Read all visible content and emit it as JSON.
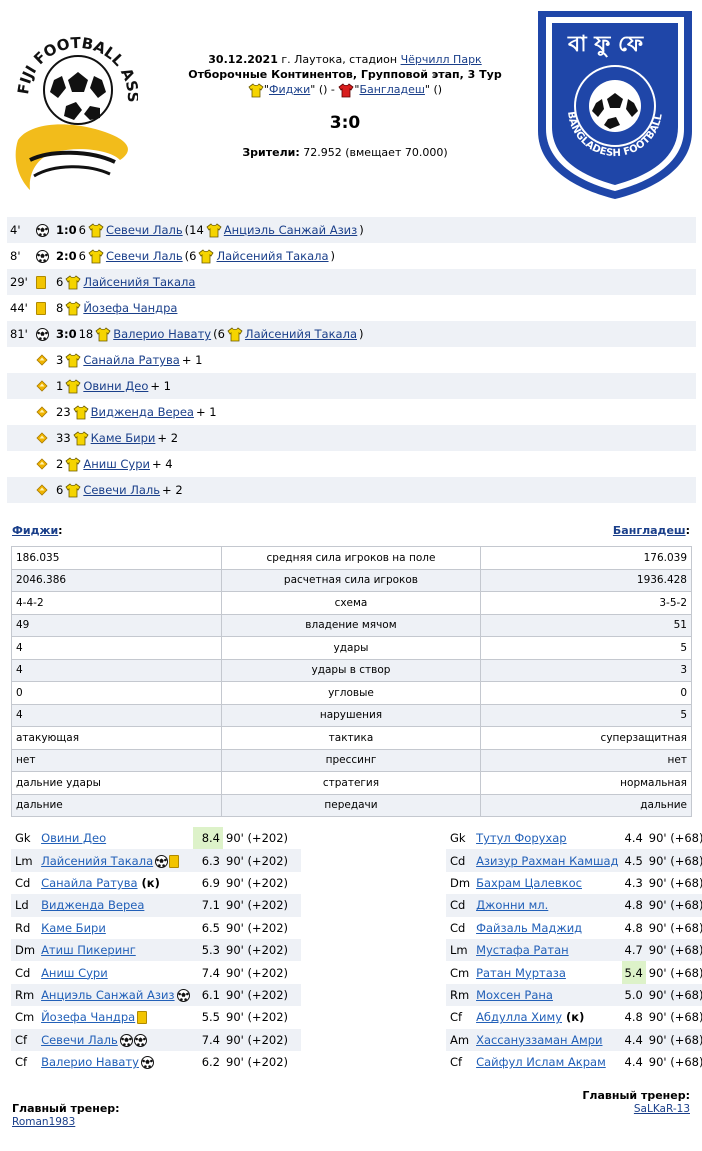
{
  "match": {
    "date": "30.12.2021",
    "venue_prefix": " г. Лаутока, стадион ",
    "stadium": "Чёрчилл Парк",
    "tournament": "Отборочные Континентов, Групповой этап, 3 Тур",
    "home_team": "Фиджи",
    "away_team": "Бангладеш",
    "home_extra": " ()",
    "away_extra": " ()",
    "separator": " - ",
    "score": "3:0",
    "attendance_label": "Зрители:",
    "attendance_value": " 72.952 (вмещает 70.000)"
  },
  "logos": {
    "left_text": "FIJI FOOTBALL ASSOCIATION",
    "right_text": "BANGLADESH FOOTBALL FEDERATION"
  },
  "colors": {
    "home_shirt": "#f5d400",
    "away_shirt": "#d81e1e",
    "link": "#1a3f8a",
    "alt_row": "#eef1f6",
    "highlight": "#ddf2c9",
    "card": "#f2c400"
  },
  "events": [
    {
      "minute": "4'",
      "icon": "ball-icon",
      "score": "1:0",
      "number": "6",
      "player": "Севечи Лаль",
      "assist_open": " (14",
      "assist": "Анциэль Санжай Азиз",
      "assist_close": ")"
    },
    {
      "minute": "8'",
      "icon": "ball-icon",
      "score": "2:0",
      "number": "6",
      "player": "Севечи Лаль",
      "assist_open": " (6",
      "assist": "Лайсенийя Такала",
      "assist_close": ")"
    },
    {
      "minute": "29'",
      "icon": "yellow-card-icon",
      "number": "6",
      "player": "Лайсенийя Такала"
    },
    {
      "minute": "44'",
      "icon": "yellow-card-icon",
      "number": "8",
      "player": "Йозефа Чандра"
    },
    {
      "minute": "81'",
      "icon": "ball-icon",
      "score": "3:0",
      "number": "18",
      "player": "Валерио Навату",
      "assist_open": " (6",
      "assist": "Лайсенийя Такала",
      "assist_close": ")"
    },
    {
      "icon": "rating-up-icon",
      "number": "3",
      "player": "Санайла Ратува",
      "suffix": " + 1"
    },
    {
      "icon": "rating-up-icon",
      "number": "1",
      "player": "Овини Део",
      "suffix": " + 1"
    },
    {
      "icon": "rating-up-icon",
      "number": "23",
      "player": "Видженда Вереа",
      "suffix": " + 1"
    },
    {
      "icon": "rating-up-icon",
      "number": "33",
      "player": "Каме Бири",
      "suffix": " + 2"
    },
    {
      "icon": "rating-up-icon",
      "number": "2",
      "player": "Аниш Сури",
      "suffix": " + 4"
    },
    {
      "icon": "rating-up-icon",
      "number": "6",
      "player": "Севечи Лаль",
      "suffix": " + 2"
    }
  ],
  "teams": {
    "home_label": "Фиджи",
    "away_label": "Бангладеш",
    "colon": ":"
  },
  "stats": [
    {
      "home": "186.035",
      "label": "средняя сила игроков на поле",
      "away": "176.039"
    },
    {
      "home": "2046.386",
      "label": "расчетная сила игроков",
      "away": "1936.428"
    },
    {
      "home": "4-4-2",
      "label": "схема",
      "away": "3-5-2"
    },
    {
      "home": "49",
      "label": "владение мячом",
      "away": "51"
    },
    {
      "home": "4",
      "label": "удары",
      "away": "5"
    },
    {
      "home": "4",
      "label": "удары в створ",
      "away": "3"
    },
    {
      "home": "0",
      "label": "угловые",
      "away": "0"
    },
    {
      "home": "4",
      "label": "нарушения",
      "away": "5"
    },
    {
      "home": "атакующая",
      "label": "тактика",
      "away": "суперзащитная"
    },
    {
      "home": "нет",
      "label": "прессинг",
      "away": "нет"
    },
    {
      "home": "дальние удары",
      "label": "стратегия",
      "away": "нормальная"
    },
    {
      "home": "дальние",
      "label": "передачи",
      "away": "дальние"
    }
  ],
  "lineup_home": [
    {
      "pos": "Gk",
      "name": "Овини Део",
      "extra": "",
      "icons": [],
      "rating": "8.4",
      "highlight": true,
      "mins": "90' (+202)"
    },
    {
      "pos": "Lm",
      "name": "Лайсенийя Такала",
      "extra": "",
      "icons": [
        "ball-icon",
        "yellow-card-icon"
      ],
      "rating": "6.3",
      "highlight": false,
      "mins": "90' (+202)"
    },
    {
      "pos": "Cd",
      "name": "Санайла Ратува",
      "extra": " (к)",
      "icons": [],
      "rating": "6.9",
      "highlight": false,
      "mins": "90' (+202)"
    },
    {
      "pos": "Ld",
      "name": "Видженда Вереа",
      "extra": "",
      "icons": [],
      "rating": "7.1",
      "highlight": false,
      "mins": "90' (+202)"
    },
    {
      "pos": "Rd",
      "name": "Каме Бири",
      "extra": "",
      "icons": [],
      "rating": "6.5",
      "highlight": false,
      "mins": "90' (+202)"
    },
    {
      "pos": "Dm",
      "name": "Атиш Пикеринг",
      "extra": "",
      "icons": [],
      "rating": "5.3",
      "highlight": false,
      "mins": "90' (+202)"
    },
    {
      "pos": "Cd",
      "name": "Аниш Сури",
      "extra": "",
      "icons": [],
      "rating": "7.4",
      "highlight": false,
      "mins": "90' (+202)"
    },
    {
      "pos": "Rm",
      "name": "Анциэль Санжай Азиз",
      "extra": "",
      "icons": [
        "ball-icon"
      ],
      "rating": "6.1",
      "highlight": false,
      "mins": "90' (+202)"
    },
    {
      "pos": "Cm",
      "name": "Йозефа Чандра",
      "extra": "",
      "icons": [
        "yellow-card-icon"
      ],
      "rating": "5.5",
      "highlight": false,
      "mins": "90' (+202)"
    },
    {
      "pos": "Cf",
      "name": "Севечи Лаль",
      "extra": "",
      "icons": [
        "ball-icon",
        "ball-icon"
      ],
      "rating": "7.4",
      "highlight": false,
      "mins": "90' (+202)"
    },
    {
      "pos": "Cf",
      "name": "Валерио Навату",
      "extra": "",
      "icons": [
        "ball-icon"
      ],
      "rating": "6.2",
      "highlight": false,
      "mins": "90' (+202)"
    }
  ],
  "lineup_away": [
    {
      "pos": "Gk",
      "name": "Тутул Форухар",
      "extra": "",
      "rating": "4.4",
      "highlight": false,
      "mins": "90' (+68)"
    },
    {
      "pos": "Cd",
      "name": "Азизур Рахман Камшад",
      "extra": "",
      "rating": "4.5",
      "highlight": false,
      "mins": "90' (+68)"
    },
    {
      "pos": "Dm",
      "name": "Бахрам Цалевкос",
      "extra": "",
      "rating": "4.3",
      "highlight": false,
      "mins": "90' (+68)"
    },
    {
      "pos": "Cd",
      "name": "Джонни мл.",
      "extra": "",
      "rating": "4.8",
      "highlight": false,
      "mins": "90' (+68)"
    },
    {
      "pos": "Cd",
      "name": "Файзаль Маджид",
      "extra": "",
      "rating": "4.8",
      "highlight": false,
      "mins": "90' (+68)"
    },
    {
      "pos": "Lm",
      "name": "Мустафа Ратан",
      "extra": "",
      "rating": "4.7",
      "highlight": false,
      "mins": "90' (+68)"
    },
    {
      "pos": "Cm",
      "name": "Ратан Муртаза",
      "extra": "",
      "rating": "5.4",
      "highlight": true,
      "mins": "90' (+68)"
    },
    {
      "pos": "Rm",
      "name": "Мохсен Рана",
      "extra": "",
      "rating": "5.0",
      "highlight": false,
      "mins": "90' (+68)"
    },
    {
      "pos": "Cf",
      "name": "Абдулла Химу",
      "extra": " (к)",
      "rating": "4.8",
      "highlight": false,
      "mins": "90' (+68)"
    },
    {
      "pos": "Am",
      "name": "Хассануззаман Амри",
      "extra": "",
      "rating": "4.4",
      "highlight": false,
      "mins": "90' (+68)"
    },
    {
      "pos": "Cf",
      "name": "Сайфул Ислам Акрам",
      "extra": "",
      "rating": "4.4",
      "highlight": false,
      "mins": "90' (+68)"
    }
  ],
  "coaches": {
    "label": "Главный тренер:",
    "home": "Roman1983",
    "away": "SaLKaR-13"
  }
}
